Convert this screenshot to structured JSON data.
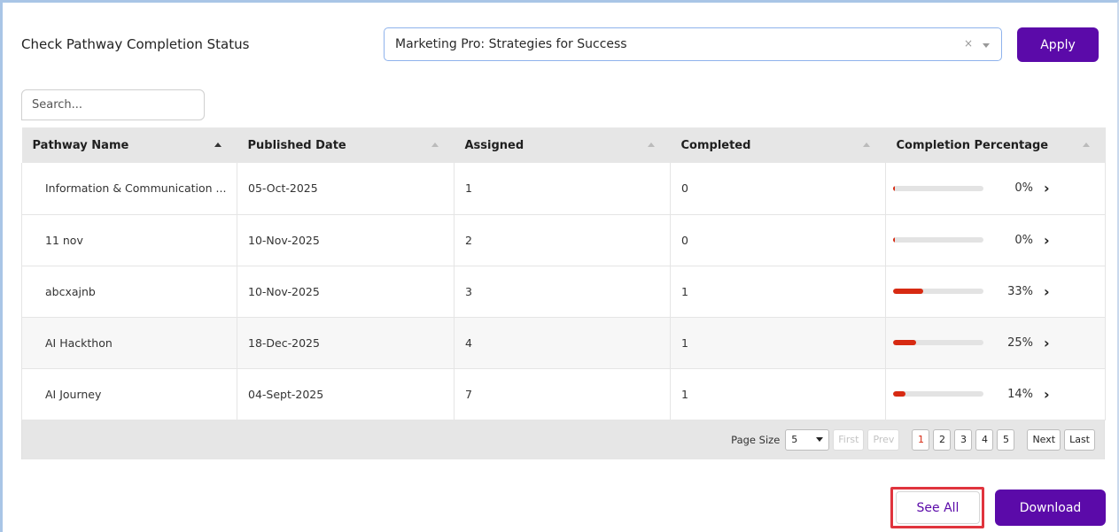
{
  "header": {
    "title": "Check Pathway Completion Status",
    "select_value": "Marketing Pro: Strategies for Success",
    "clear_glyph": "×",
    "apply_label": "Apply"
  },
  "search": {
    "placeholder": "Search..."
  },
  "table": {
    "columns": [
      "Pathway Name",
      "Published Date",
      "Assigned",
      "Completed",
      "Completion Percentage"
    ],
    "rows": [
      {
        "name": "Information & Communication ...",
        "date": "05-Oct-2025",
        "assigned": "1",
        "completed": "0",
        "percent_label": "0%",
        "percent": 2
      },
      {
        "name": "11 nov",
        "date": "10-Nov-2025",
        "assigned": "2",
        "completed": "0",
        "percent_label": "0%",
        "percent": 2
      },
      {
        "name": "abcxajnb",
        "date": "10-Nov-2025",
        "assigned": "3",
        "completed": "1",
        "percent_label": "33%",
        "percent": 33
      },
      {
        "name": "AI Hackthon",
        "date": "18-Dec-2025",
        "assigned": "4",
        "completed": "1",
        "percent_label": "25%",
        "percent": 25
      },
      {
        "name": "AI Journey",
        "date": "04-Sept-2025",
        "assigned": "7",
        "completed": "1",
        "percent_label": "14%",
        "percent": 14
      }
    ]
  },
  "pager": {
    "page_size_label": "Page Size",
    "page_size": "5",
    "first": "First",
    "prev": "Prev",
    "pages": [
      "1",
      "2",
      "3",
      "4",
      "5"
    ],
    "next": "Next",
    "last": "Last"
  },
  "footer": {
    "see_all_label": "See All",
    "download_label": "Download"
  },
  "colors": {
    "primary": "#5b0aa9",
    "progress_fill": "#d72a12",
    "highlight_border": "#e0343d"
  }
}
